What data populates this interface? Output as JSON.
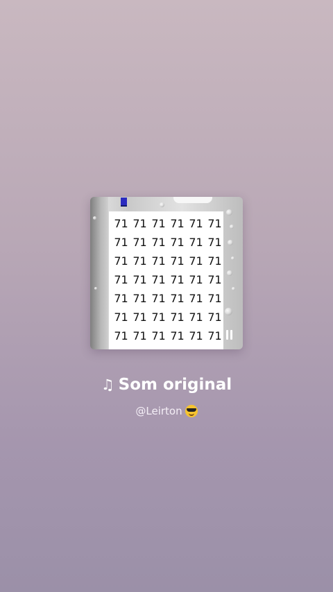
{
  "sound": {
    "note_icon": "music-note-icon",
    "note_glyph": "♫",
    "title": "Som original",
    "author": "@Leirton",
    "author_emoji": "sunglasses-emoji-icon"
  },
  "cover": {
    "grid_value": "71",
    "rows": 7,
    "columns": 6,
    "state_icon": "pause-icon"
  }
}
